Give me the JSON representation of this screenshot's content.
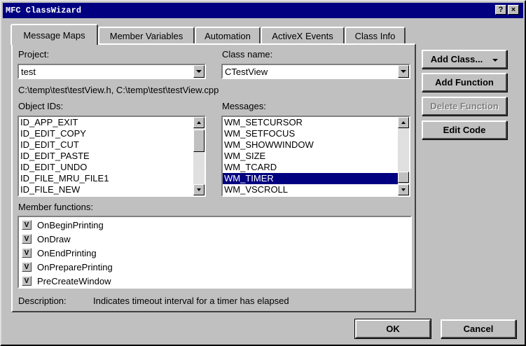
{
  "window": {
    "title": "MFC ClassWizard",
    "help_btn": "?",
    "close_btn": "×"
  },
  "tabs": [
    {
      "label": "Message Maps",
      "active": true
    },
    {
      "label": "Member Variables"
    },
    {
      "label": "Automation"
    },
    {
      "label": "ActiveX Events"
    },
    {
      "label": "Class Info"
    }
  ],
  "project": {
    "label": "Project:",
    "value": "test"
  },
  "class_name": {
    "label": "Class name:",
    "value": "CTestView"
  },
  "file_path": "C:\\temp\\test\\testView.h, C:\\temp\\test\\testView.cpp",
  "object_ids": {
    "label": "Object IDs:",
    "items": [
      "ID_APP_EXIT",
      "ID_EDIT_COPY",
      "ID_EDIT_CUT",
      "ID_EDIT_PASTE",
      "ID_EDIT_UNDO",
      "ID_FILE_MRU_FILE1",
      "ID_FILE_NEW"
    ]
  },
  "messages": {
    "label": "Messages:",
    "items": [
      "WM_SETCURSOR",
      "WM_SETFOCUS",
      "WM_SHOWWINDOW",
      "WM_SIZE",
      "WM_TCARD",
      "WM_TIMER",
      "WM_VSCROLL"
    ],
    "selected": "WM_TIMER"
  },
  "member_functions": {
    "label": "Member functions:",
    "items": [
      {
        "badge": "V",
        "name": "OnBeginPrinting"
      },
      {
        "badge": "V",
        "name": "OnDraw"
      },
      {
        "badge": "V",
        "name": "OnEndPrinting"
      },
      {
        "badge": "V",
        "name": "OnPreparePrinting"
      },
      {
        "badge": "V",
        "name": "PreCreateWindow"
      }
    ]
  },
  "description": {
    "label": "Description:",
    "text": "Indicates timeout interval for a timer has elapsed"
  },
  "buttons": {
    "add_class": "Add Class...",
    "add_function": "Add Function",
    "delete_function": "Delete Function",
    "edit_code": "Edit Code",
    "ok": "OK",
    "cancel": "Cancel"
  },
  "colors": {
    "title_bar": "#000080",
    "face": "#c0c0c0",
    "selection": "#000080"
  }
}
